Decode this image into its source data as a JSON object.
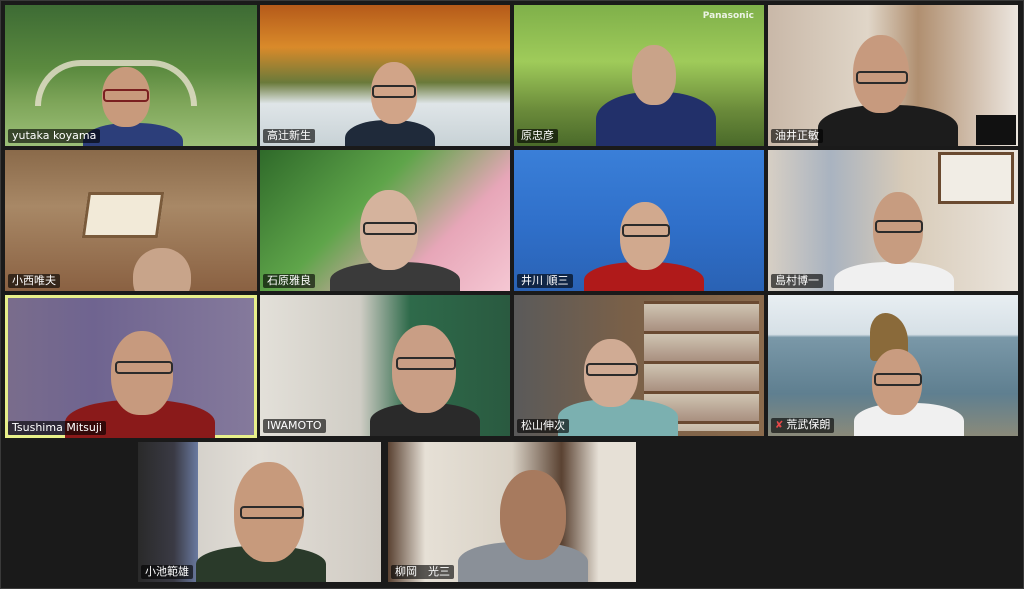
{
  "participants": [
    {
      "name": "yutaka koyama",
      "muted": false
    },
    {
      "name": "高辻新生",
      "muted": false
    },
    {
      "name": "原忠彦",
      "muted": false
    },
    {
      "name": "油井正敏",
      "muted": false
    },
    {
      "name": "小西唯夫",
      "muted": false
    },
    {
      "name": "石原雅良",
      "muted": false
    },
    {
      "name": "井川 順三",
      "muted": false
    },
    {
      "name": "島村博一",
      "muted": false
    },
    {
      "name": "Tsushima Mitsuji",
      "muted": false,
      "active_speaker": true
    },
    {
      "name": "IWAMOTO",
      "muted": false
    },
    {
      "name": "松山伸次",
      "muted": false
    },
    {
      "name": "荒武保朗",
      "muted": true
    },
    {
      "name": "小池範雄",
      "muted": false
    },
    {
      "name": "柳岡　光三",
      "muted": false
    }
  ],
  "watermark": "Panasonic",
  "colors": {
    "active_border": "#e8f08a",
    "mute_icon": "#e54848",
    "background": "#1a1a1a"
  }
}
